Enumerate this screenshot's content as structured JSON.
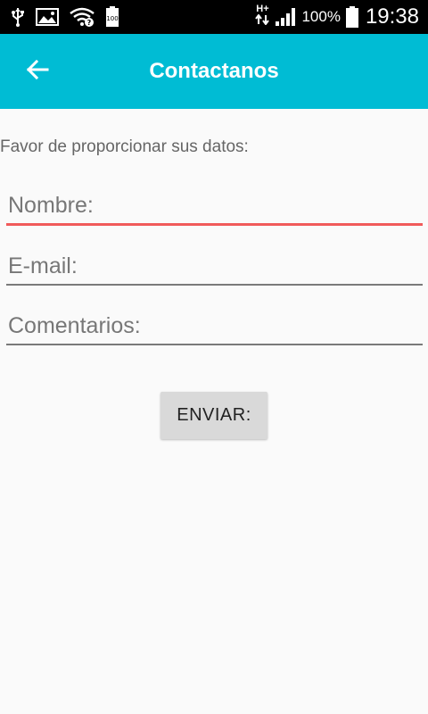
{
  "status_bar": {
    "battery_small_label": "100",
    "network_label": "H+",
    "battery_percent": "100%",
    "time": "19:38",
    "icons": [
      "usb-icon",
      "image-icon",
      "wifi-question-icon",
      "battery-saver-icon",
      "network-arrows-icon",
      "signal-icon",
      "battery-icon"
    ]
  },
  "app_bar": {
    "title": "Contactanos",
    "back_icon": "arrow-back-icon"
  },
  "form": {
    "intro": "Favor de proporcionar sus datos:",
    "name_placeholder": "Nombre:",
    "email_placeholder": "E-mail:",
    "comments_placeholder": "Comentarios:",
    "submit_label": "ENVIAR:"
  },
  "colors": {
    "app_bar": "#00bcd4",
    "focused_underline": "#f05a5a",
    "button": "#d9d9d9"
  }
}
